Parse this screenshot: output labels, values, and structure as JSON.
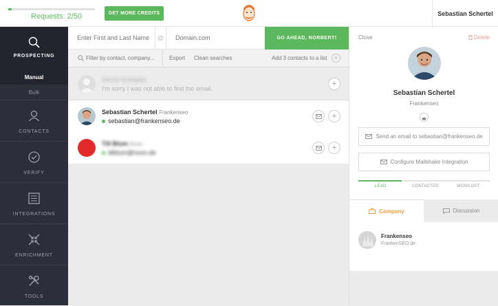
{
  "colors": {
    "accent": "#5cb85c",
    "sidebar": "#2c2e3a",
    "company_tab": "#f0a040",
    "delete": "#e89a9a"
  },
  "topbar": {
    "requests_label": "Requests: 2/50",
    "requests_progress": 0.04,
    "credits_button": "GET MORE CREDITS",
    "logo_icon": "hunter-face-logo",
    "user_name": "Sebastian Schertel"
  },
  "sidebar": {
    "items": [
      {
        "label": "PROSPECTING",
        "icon": "search-icon",
        "active": true
      },
      {
        "label": "CONTACTS",
        "icon": "user-icon"
      },
      {
        "label": "VERIFY",
        "icon": "check-circle-icon"
      },
      {
        "label": "INTEGRATIONS",
        "icon": "integrations-icon"
      },
      {
        "label": "ENRICHMENT",
        "icon": "enrichment-icon"
      },
      {
        "label": "TOOLS",
        "icon": "tools-icon"
      }
    ],
    "sub": {
      "manual": "Manual",
      "bulk": "Bulk"
    }
  },
  "search": {
    "name_placeholder": "Enter First and Last Name",
    "at": "@",
    "domain_placeholder": "Domain.com",
    "go_button": "GO AHEAD, NORBERT!"
  },
  "filter": {
    "placeholder": "Filter by contact, company...",
    "export": "Export",
    "clean": "Clean searches",
    "add_to_list": "Add 3 contacts to a list",
    "plus": "+"
  },
  "rows": [
    {
      "name": "Ulrich Schapke",
      "message": "I'm sorry I was not able to find the email."
    },
    {
      "name": "Sebastian Schertel",
      "company": "Frankenseo",
      "email": "sebastian@frankenseo.de"
    },
    {
      "name": "Till Blum",
      "company": "Noon",
      "email": "tillblum@noon.de"
    }
  ],
  "detail": {
    "close": "Close",
    "delete": "Delete",
    "name": "Sebastian Schertel",
    "company": "Frankenseo",
    "send_email": "Send an email to sebastian@frankenseo.de",
    "mailshake": "Configure Mailshake Integration",
    "stages": [
      "LEAD",
      "CONTACTED",
      "WON/LOST"
    ],
    "stage_progress": 0.33,
    "tabs": {
      "company": "Company",
      "discussion": "Discussion"
    },
    "company_card": {
      "name": "Frankenseo",
      "domain": "FrankenSEO.de"
    }
  }
}
